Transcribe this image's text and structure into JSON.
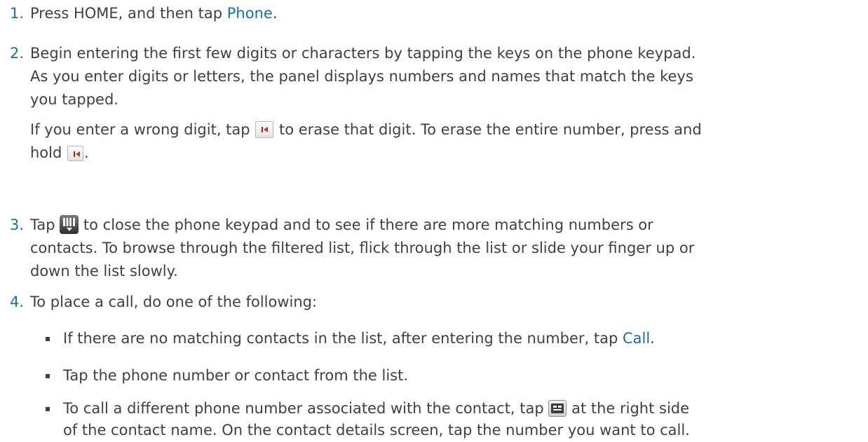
{
  "steps": {
    "s1": {
      "num": "1.",
      "t1": "Press HOME, and then tap ",
      "t1_em": "Phone",
      "t1_end": "."
    },
    "s2": {
      "num": "2.",
      "line1": "Begin entering the first few digits or characters by tapping the keys on the phone keypad.",
      "line2": "As you enter digits or letters, the panel displays numbers and names that match the keys",
      "line3": "you tapped.",
      "erase_a": "If you enter a wrong digit, tap ",
      "erase_b": " to erase that digit. To erase the entire number, press and",
      "erase_c": "hold ",
      "erase_d": "."
    },
    "s3": {
      "num": "3.",
      "line1a": "Tap ",
      "line1b": " to close the phone keypad and to see if there are more matching numbers or",
      "line2": "contacts. To browse through the filtered list, flick through the list or slide your finger up or",
      "line3": "down the list slowly."
    },
    "s4": {
      "num": "4.",
      "intro": "To place a call, do one of the following:",
      "b1a": "If there are no matching contacts in the list, after entering the number, tap ",
      "b1_em": "Call",
      "b1_end": ".",
      "b2": "Tap the phone number or contact from the list.",
      "b3a": "To call a different phone number associated with the contact, tap ",
      "b3b": " at the right side",
      "b3c": "of the contact name. On the contact details screen, tap the number you want to call."
    }
  },
  "icons": {
    "backspace": "backspace-icon",
    "keypad": "keypad-toggle-icon",
    "contact_card": "contact-details-icon"
  },
  "colors": {
    "step_number": "#1a6fa3",
    "emphasis": "#1a6fa3",
    "body_text": "#404040"
  }
}
